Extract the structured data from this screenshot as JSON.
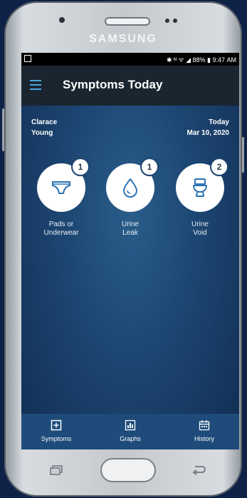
{
  "device": {
    "brand": "SAMSUNG"
  },
  "status_bar": {
    "text": "✱ ᴺ ᯤ ◢ 88% ▮ 9:47 AM"
  },
  "app_bar": {
    "title": "Symptoms Today"
  },
  "patient": {
    "first_name": "Clarace",
    "last_name": "Young"
  },
  "date_info": {
    "label": "Today",
    "date": "Mar 10, 2020"
  },
  "tiles": [
    {
      "line1": "Pads or",
      "line2": "Underwear",
      "count": "1",
      "icon": "underwear-icon"
    },
    {
      "line1": "Urine",
      "line2": "Leak",
      "count": "1",
      "icon": "droplet-icon"
    },
    {
      "line1": "Urine",
      "line2": "Void",
      "count": "2",
      "icon": "toilet-icon"
    }
  ],
  "tabs": [
    {
      "label": "Symptoms",
      "icon": "plus-square-icon"
    },
    {
      "label": "Graphs",
      "icon": "chart-icon"
    },
    {
      "label": "History",
      "icon": "calendar-icon"
    }
  ],
  "colors": {
    "app_bar": "#1a2530",
    "screen_bg": "#1c4571",
    "tab_bar": "#1e4b7a",
    "accent": "#4aa6e0"
  }
}
